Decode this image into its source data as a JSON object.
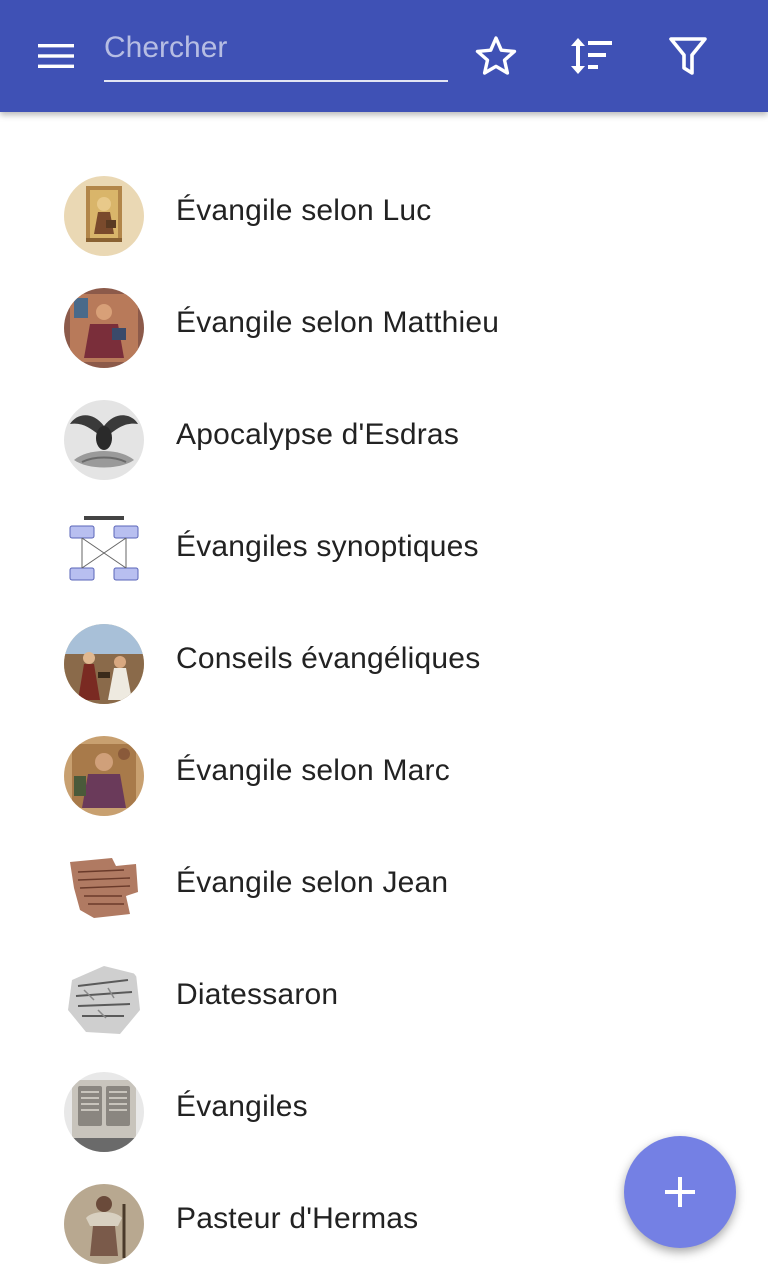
{
  "colors": {
    "app_bar": "#3f51b5",
    "fab": "#7480e4",
    "text": "#222222",
    "icon": "#ffffff"
  },
  "app_bar": {
    "menu_icon": "hamburger-menu-icon",
    "search": {
      "placeholder": "Chercher",
      "value": ""
    },
    "actions": [
      "star-icon",
      "sort-icon",
      "filter-icon"
    ]
  },
  "list": {
    "items": [
      {
        "label": "Évangile selon Luc",
        "thumbnail": "illuminated-manuscript-luke"
      },
      {
        "label": "Évangile selon Matthieu",
        "thumbnail": "illuminated-manuscript-matthew"
      },
      {
        "label": "Apocalypse d'Esdras",
        "thumbnail": "eagle-engraving"
      },
      {
        "label": "Évangiles synoptiques",
        "thumbnail": "synoptic-diagram"
      },
      {
        "label": "Conseils évangéliques",
        "thumbnail": "religious-painting"
      },
      {
        "label": "Évangile selon Marc",
        "thumbnail": "illuminated-manuscript-mark"
      },
      {
        "label": "Évangile selon Jean",
        "thumbnail": "papyrus-fragment"
      },
      {
        "label": "Diatessaron",
        "thumbnail": "manuscript-fragment"
      },
      {
        "label": "Évangiles",
        "thumbnail": "stone-tablet-monument"
      },
      {
        "label": "Pasteur d'Hermas",
        "thumbnail": "shepherd-fresco"
      }
    ]
  },
  "fab": {
    "icon": "plus-icon"
  }
}
